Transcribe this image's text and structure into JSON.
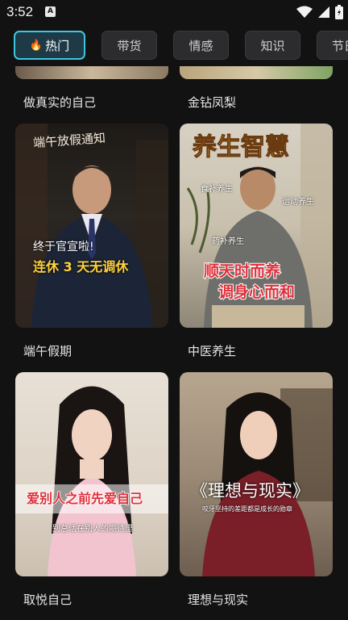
{
  "status": {
    "time": "3:52"
  },
  "tabs": [
    {
      "label": "热门",
      "active": true
    },
    {
      "label": "带货",
      "active": false
    },
    {
      "label": "情感",
      "active": false
    },
    {
      "label": "知识",
      "active": false
    },
    {
      "label": "节日",
      "active": false
    }
  ],
  "top_row": [
    {
      "title": "做真实的自己"
    },
    {
      "title": "金钻凤梨"
    }
  ],
  "cards": [
    {
      "title": "端午假期",
      "overlay": {
        "headline": "端午放假通知",
        "line1": "终于官宣啦!",
        "line2": "连休 3 天无调休"
      }
    },
    {
      "title": "中医养生",
      "overlay": {
        "headline": "养生智慧",
        "tag1": "食补养生",
        "tag2": "运动养生",
        "tag3": "药补养生",
        "line1": "顺天时而养",
        "line2": "调身心而和"
      }
    },
    {
      "title": "取悦自己",
      "overlay": {
        "line1": "爱别人之前先爱自己",
        "line2": "别总活在别人的期待里"
      }
    },
    {
      "title": "理想与现实",
      "overlay": {
        "headline": "《理想与现实》",
        "line1": "咬牙坚持的差距都是成长的勋章"
      }
    }
  ],
  "colors": {
    "accent": "#3ec6e0",
    "highlight_red": "#e0303a",
    "highlight_yellow": "#ffd23a"
  }
}
